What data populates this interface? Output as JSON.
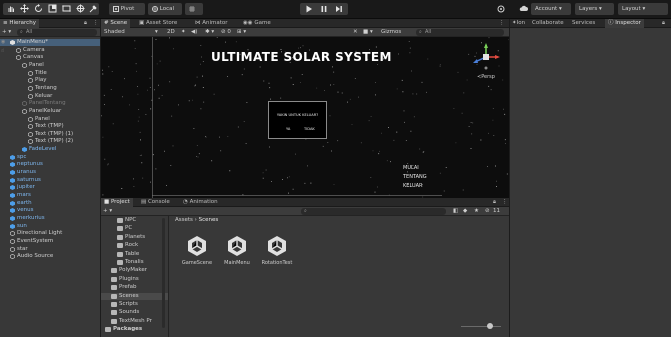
{
  "toolbar": {
    "tool_icons": [
      "hand-icon",
      "move-icon",
      "rotate-icon",
      "scale-icon",
      "rect-icon",
      "transform-icon",
      "custom-tool-icon"
    ],
    "pivot_label": "Pivot",
    "local_label": "Local",
    "snap_label": "",
    "account_label": "Account",
    "layers_label": "Layers",
    "layout_label": "Layout"
  },
  "hierarchy": {
    "tab_label": "Hierarchy",
    "search_label": "All",
    "rows": [
      {
        "label": "MainMenu*",
        "indent": 0,
        "kind": "scene"
      },
      {
        "label": "Camera",
        "indent": 1,
        "kind": "go"
      },
      {
        "label": "Canvas",
        "indent": 1,
        "kind": "go"
      },
      {
        "label": "Panel",
        "indent": 2,
        "kind": "go"
      },
      {
        "label": "Title",
        "indent": 3,
        "kind": "go"
      },
      {
        "label": "Play",
        "indent": 3,
        "kind": "go"
      },
      {
        "label": "Tentang",
        "indent": 3,
        "kind": "go"
      },
      {
        "label": "Keluar",
        "indent": 3,
        "kind": "go"
      },
      {
        "label": "PanelTentang",
        "indent": 2,
        "kind": "disabled"
      },
      {
        "label": "PanelKeluar",
        "indent": 2,
        "kind": "go"
      },
      {
        "label": "Panel",
        "indent": 3,
        "kind": "go"
      },
      {
        "label": "Text (TMP)",
        "indent": 3,
        "kind": "go"
      },
      {
        "label": "Text (TMP) (1)",
        "indent": 3,
        "kind": "go"
      },
      {
        "label": "Text (TMP) (2)",
        "indent": 3,
        "kind": "go"
      },
      {
        "label": "FadeLevel",
        "indent": 2,
        "kind": "prefab"
      },
      {
        "label": "spc",
        "indent": 0,
        "kind": "prefab"
      },
      {
        "label": "neptunus",
        "indent": 0,
        "kind": "prefab"
      },
      {
        "label": "uranus",
        "indent": 0,
        "kind": "prefab"
      },
      {
        "label": "saturnus",
        "indent": 0,
        "kind": "prefab"
      },
      {
        "label": "jupiter",
        "indent": 0,
        "kind": "prefab"
      },
      {
        "label": "mars",
        "indent": 0,
        "kind": "prefab"
      },
      {
        "label": "earth",
        "indent": 0,
        "kind": "prefab"
      },
      {
        "label": "venus",
        "indent": 0,
        "kind": "prefab"
      },
      {
        "label": "merkurius",
        "indent": 0,
        "kind": "prefab"
      },
      {
        "label": "sun",
        "indent": 0,
        "kind": "prefab"
      },
      {
        "label": "Directional Light",
        "indent": 0,
        "kind": "go"
      },
      {
        "label": "EventSystem",
        "indent": 0,
        "kind": "go"
      },
      {
        "label": "star",
        "indent": 0,
        "kind": "go"
      },
      {
        "label": "Audio Source",
        "indent": 0,
        "kind": "go"
      }
    ]
  },
  "scene": {
    "tabs": [
      "Scene",
      "Asset Store",
      "Animator",
      "Game"
    ],
    "shading": "Shaded",
    "mode_2d": "2D",
    "gizmos_label": "Gizmos",
    "search_label": "All",
    "persp_label": "Persp",
    "title": "ULTIMATE SOLAR SYSTEM",
    "dialog_text": "YAKIN UNTUK KELUAR?",
    "dialog_yes": "YA",
    "dialog_no": "TIDAK",
    "menu_items": [
      "MULAI",
      "TENTANG",
      "KELUAR"
    ]
  },
  "project": {
    "tabs": [
      "Project",
      "Console",
      "Animation"
    ],
    "breadcrumb_root": "Assets",
    "breadcrumb_current": "Scenes",
    "hidden_count": "11",
    "tree": [
      {
        "label": "NPC",
        "indent": 1
      },
      {
        "label": "PC",
        "indent": 1
      },
      {
        "label": "Planets",
        "indent": 1
      },
      {
        "label": "Rock",
        "indent": 1
      },
      {
        "label": "Table",
        "indent": 1
      },
      {
        "label": "Tonalis",
        "indent": 1
      },
      {
        "label": "PolyMaker",
        "indent": 0
      },
      {
        "label": "Plugins",
        "indent": 0
      },
      {
        "label": "Prefab",
        "indent": 0
      },
      {
        "label": "Scenes",
        "indent": 0,
        "selected": true
      },
      {
        "label": "Scripts",
        "indent": 0
      },
      {
        "label": "Sounds",
        "indent": 0
      },
      {
        "label": "TextMesh Pr",
        "indent": 0
      },
      {
        "label": "Packages",
        "indent": -1
      }
    ],
    "assets": [
      "GameScene",
      "MainMenu",
      "RotationTest"
    ]
  },
  "inspector": {
    "tabs": [
      "Inspector",
      "Collaborate",
      "Services",
      "Inspector"
    ],
    "lighting_label": "Ion"
  },
  "colors": {
    "unity_blue": "#4d9ee9",
    "selection": "#2c5d87",
    "prefab_text": "#7fb8f0"
  }
}
